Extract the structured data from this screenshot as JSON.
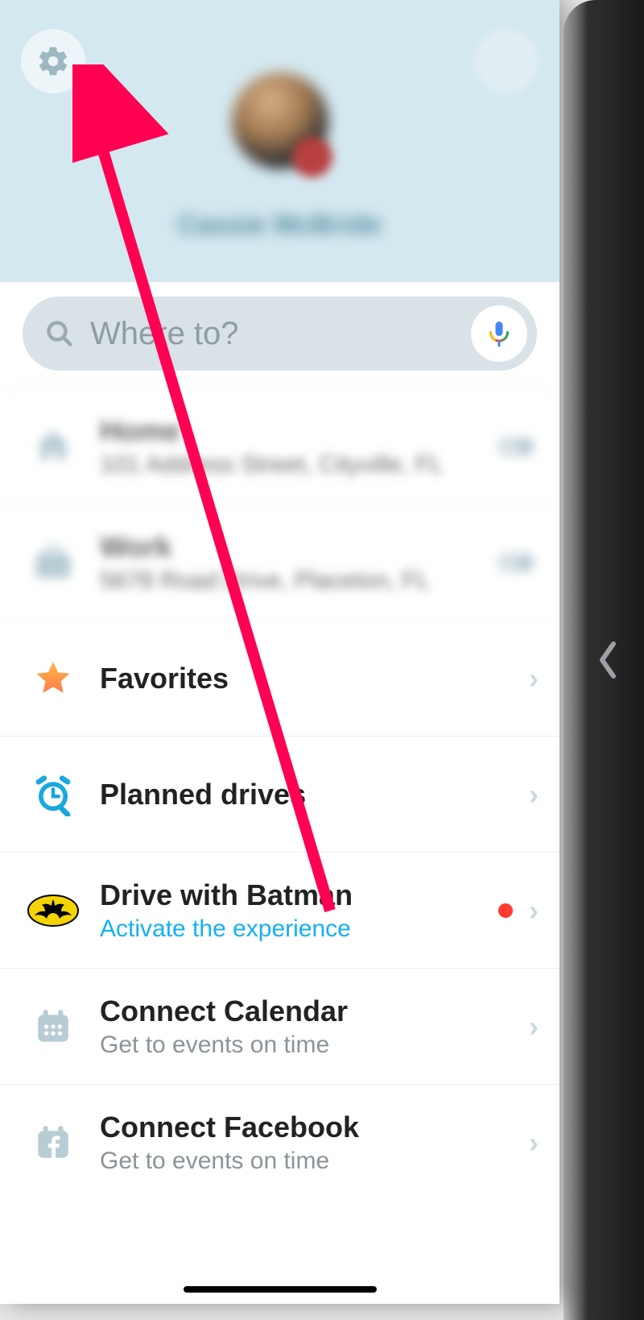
{
  "header": {
    "username_blurred": "Cassie McBride"
  },
  "search": {
    "placeholder": "Where to?"
  },
  "saved": {
    "home": {
      "label": "Home",
      "address": "101 Address Street, Cityville, FL"
    },
    "work": {
      "label": "Work",
      "address": "5678 Road Drive, Placeton, FL"
    }
  },
  "menu": {
    "favorites": {
      "title": "Favorites"
    },
    "planned": {
      "title": "Planned drives"
    },
    "batman": {
      "title": "Drive with Batman",
      "sub": "Activate the experience"
    },
    "calendar": {
      "title": "Connect Calendar",
      "sub": "Get to events on time"
    },
    "facebook": {
      "title": "Connect Facebook",
      "sub": "Get to events on time"
    }
  }
}
